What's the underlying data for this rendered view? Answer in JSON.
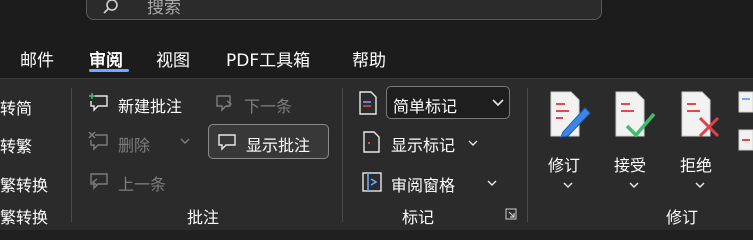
{
  "search": {
    "icon": "search-icon",
    "placeholder": "搜索"
  },
  "tabs": [
    {
      "label": "邮件",
      "active": false
    },
    {
      "label": "审阅",
      "active": true
    },
    {
      "label": "视图",
      "active": false
    },
    {
      "label": "PDF工具箱",
      "active": false
    },
    {
      "label": "帮助",
      "active": false
    }
  ],
  "chinese_convert": {
    "items": [
      "转简",
      "转繁",
      "繁转换",
      "繁转换"
    ]
  },
  "comments": {
    "new_comment": "新建批注",
    "delete": "删除",
    "previous": "上一条",
    "next": "下一条",
    "show_comments": "显示批注",
    "group_label": "批注"
  },
  "markup": {
    "display_mode": "简单标记",
    "show_markup": "显示标记",
    "reviewing_pane": "审阅窗格",
    "group_label": "标记"
  },
  "tracking": {
    "track_changes": "修订",
    "accept": "接受",
    "reject": "拒绝",
    "group_label": "修订"
  },
  "colors": {
    "accent": "#6ea8ff",
    "accept": "#3fbf6e",
    "reject": "#e0404a",
    "doc_lines": "#e04a4a"
  }
}
